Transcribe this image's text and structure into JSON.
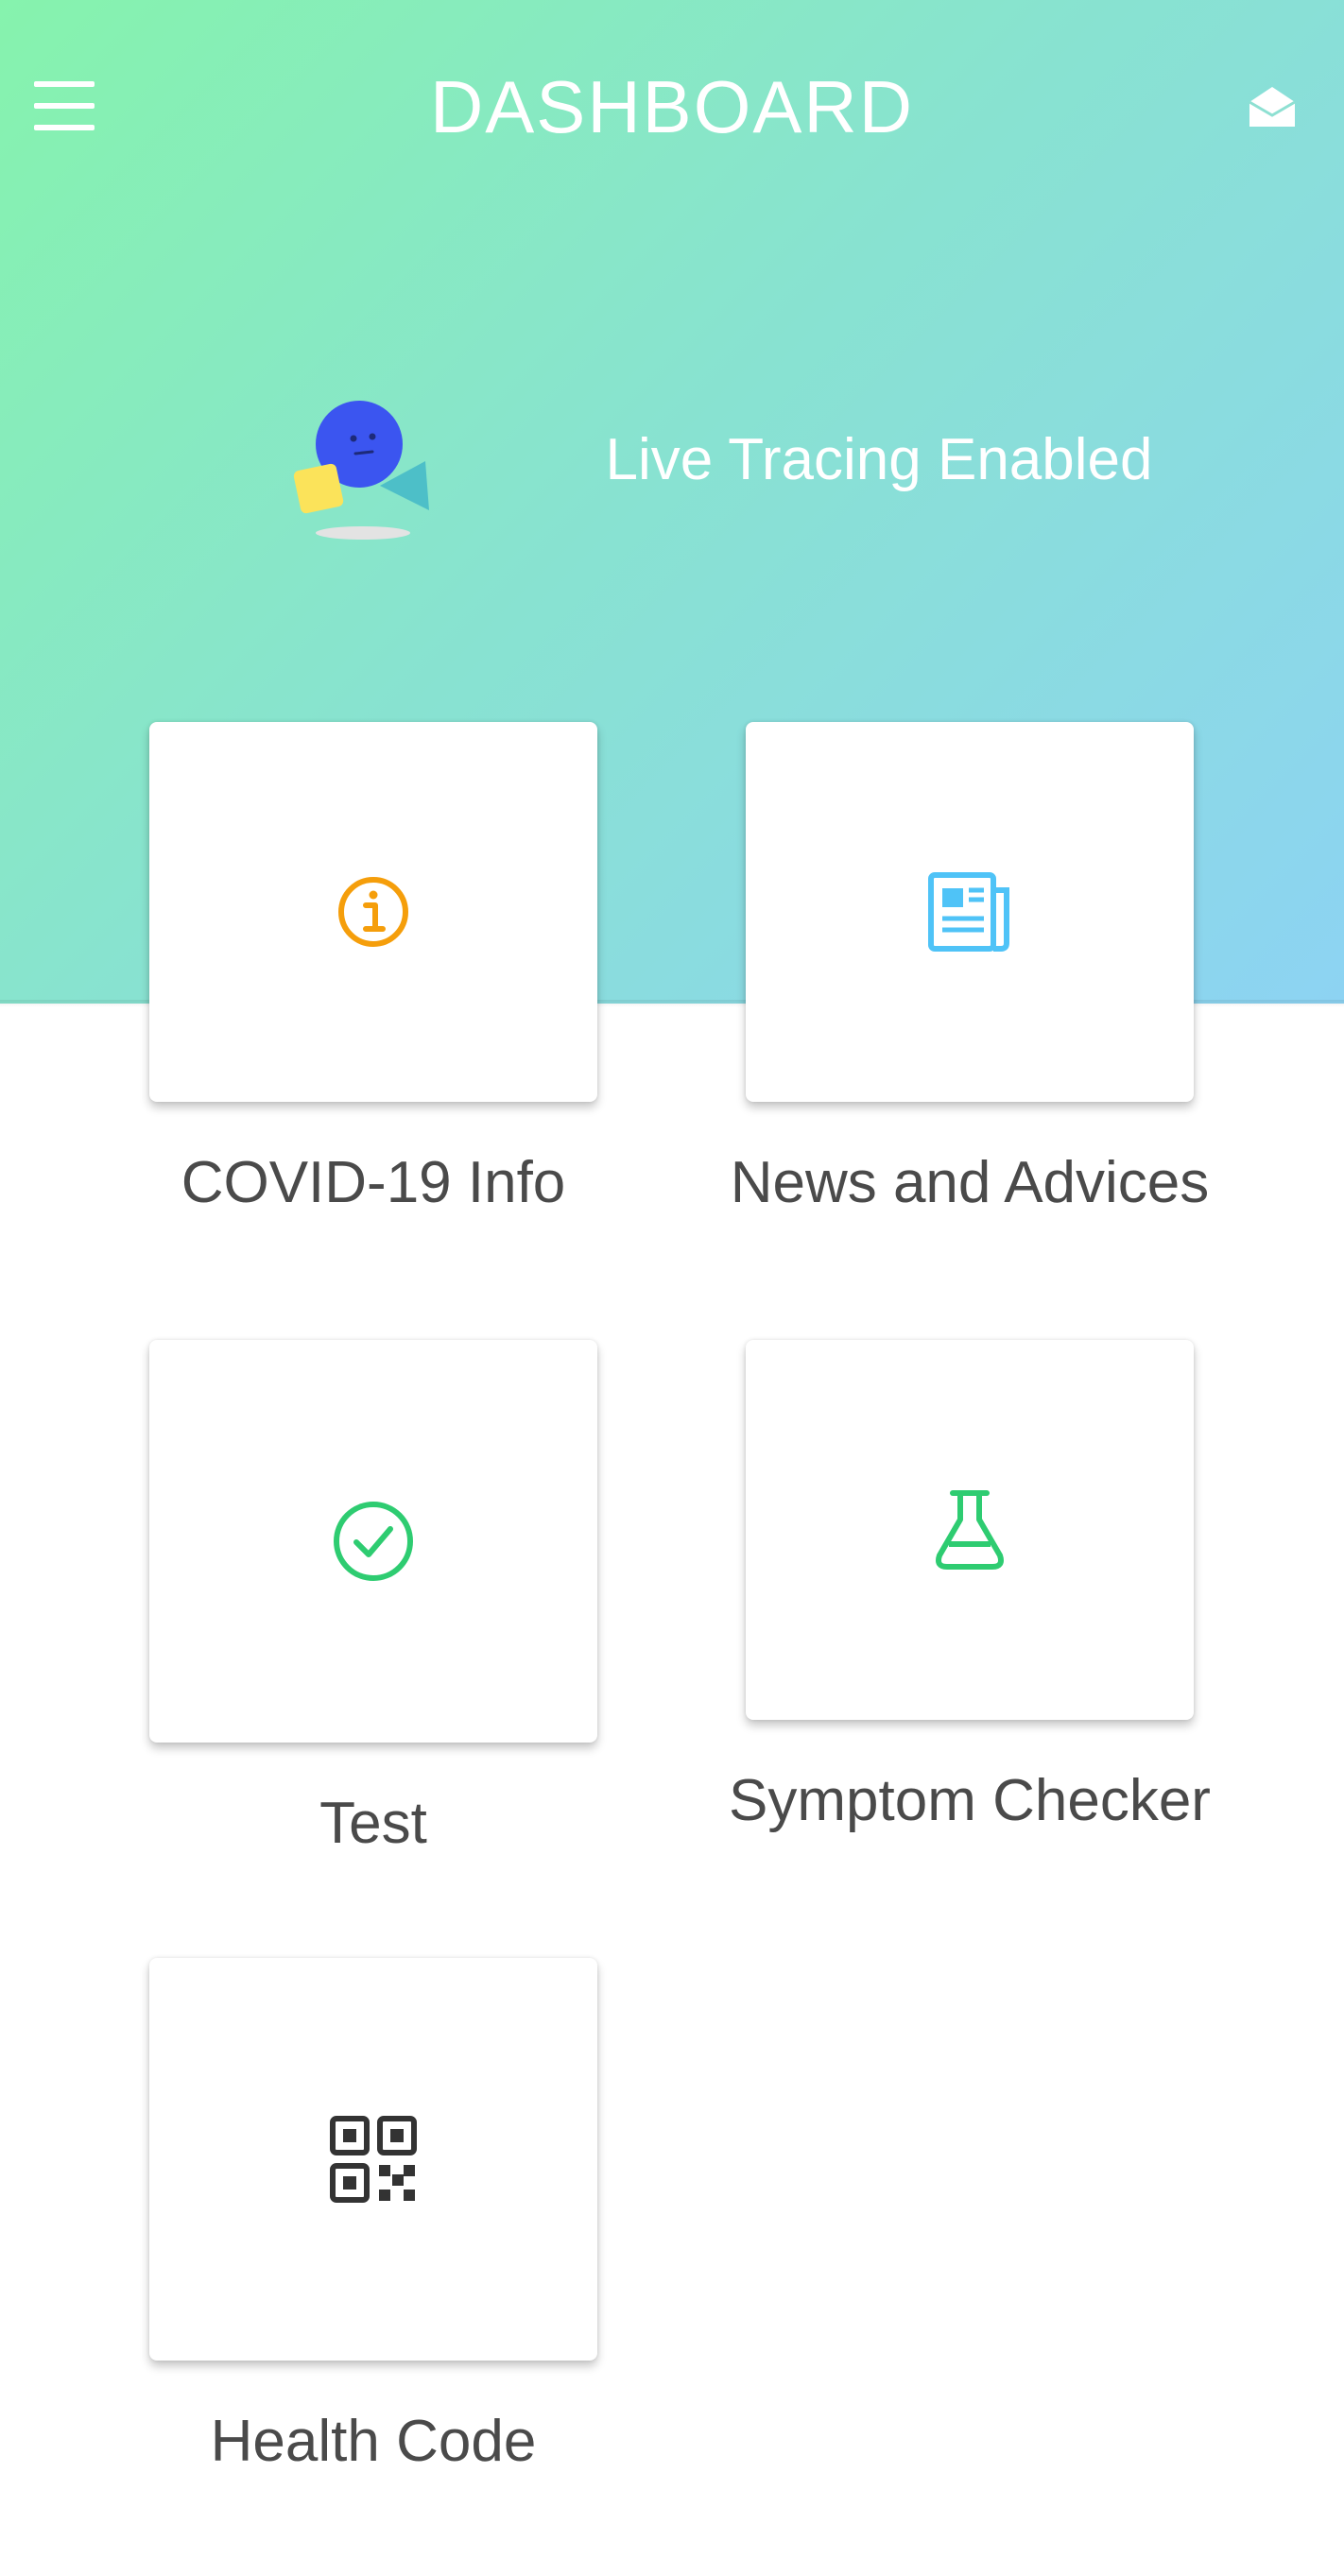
{
  "header": {
    "title": "DASHBOARD",
    "menu_icon": "hamburger-menu-icon",
    "mail_icon": "open-envelope-icon"
  },
  "status": {
    "text": "Live Tracing Enabled",
    "illustration": "mascot-illustration"
  },
  "tiles": [
    {
      "label": "COVID-19 Info",
      "icon": "info-circle-icon",
      "color": "#f59e0b"
    },
    {
      "label": "News and Advices",
      "icon": "newspaper-icon",
      "color": "#4fc3f7"
    },
    {
      "label": "Test",
      "icon": "check-circle-icon",
      "color": "#2ecc71"
    },
    {
      "label": "Symptom Checker",
      "icon": "flask-icon",
      "color": "#2ecc71"
    },
    {
      "label": "Health Code",
      "icon": "qr-code-icon",
      "color": "#333333"
    }
  ],
  "colors": {
    "gradient_start": "#86f3ad",
    "gradient_end": "#8dd3f3",
    "label_text": "#4a4a4a"
  }
}
